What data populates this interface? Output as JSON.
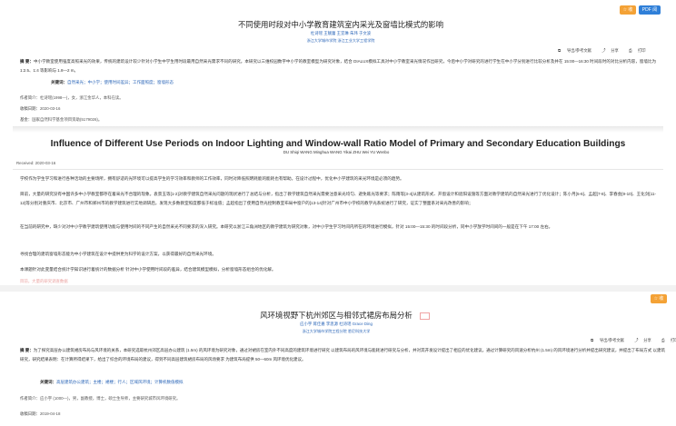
{
  "article1": {
    "buttons": {
      "favorite": "☆ 收藏",
      "pdf": "PDF 阅读"
    },
    "title": "不同使用时段对中小学教育建筑室内采光及窗墙比模式的影响",
    "authors": "杜诗瑶  王靓蕾  王宜琳  朱玮  于文波",
    "affiliation": "浙江大学城市学院  浙江工业大学工程学院",
    "actions": {
      "export": "导出/参考文献",
      "share": "分享",
      "print": "打印"
    },
    "abstract_label": "摘  要：",
    "abstract": "中小学教室使用强度高照采光的效果，传统的建筑设计较少针对小学生中学生用时段最用自然采光需求不同的研究。本研究以三维校园数字中小学的教室模型为研究对象，结合 DIALUX模拟工具对中小学教室采光情况作出研究，今后中小学对研究的进行学生在中小学分别进行比较分析及并在 15:00—16:30 时间段时的对比分析内容，窗墙比为 1:2.5、1:4 等影响与 1.8—2 m。",
    "keywords_label": "关键词：",
    "keywords": "自然采光；中小学；使用时间差异；工作面照度；窗墙形态",
    "author_info_label": "作者简介：",
    "author_info": "杜诗瑶(1998—)，女，浙江金华人，本科在读。",
    "received_label": "收稿日期：",
    "received": "2020-03-16",
    "fund_label": "基金：",
    "fund": "国家自然科学基金项目资助(5179026)。",
    "en_title": "Influence of Different Use Periods on Indoor Lighting and Window-wall Ratio Model of Primary and Secondary Education Buildings",
    "en_authors": "DU Shiqi  WANG Minghua  WANG Yikai  ZHU Wei  YU Wenbo",
    "en_received": "Received: 2020-03-16",
    "body": [
      "学校作为学生学习和进行各种活动的主要场所，拥有舒适的光环境可以提高学生的学习效率和教师的工作效率，同时对降低照明耗能的能耗也有帮助。在设计过程中，优化中小学建筑的采光环境是必须的趋势。",
      "目前，大量的研究没有中国许多中小学教室都存在着采光不合理的现象。袁景玉等[1-2]对教学建筑自然采光问题的现状进行了总结与分析，指出了教学建筑自然采光需要注意采光均匀、避免眩光等要求；陈雨等[3-4]从建筑形式、开窗设计和遮阳设施等方面对教学建筑的自然采光进行了优化设计；陈小月[5-6]、孟超[7-8]、李春会[9-10]、王化剑[11-12]等分别对重庆市、北京市、广州市和郑州市的教学建筑进行实地调研后，发现大多数教室照度都低于标准值；孟超指出了使用自然光控制教室布局中窗户的[13-14]针对广州市中小学校的教学光系统进行了研究，证实了整面系对采光改善的影响；",
      "在当前的研究中，缺少对对中小学教学建筑使用功能与使用时间的不同产生的自然采光不同要求的深入研究。本研究以浙江三角洲地区的教学建筑为研究对象，对中小学生学习时间内所在的环境进行模拟，针对 15:00—15:30 的时间段分析，同中小学放学时间间的一般是在下午 17:00 左右。",
      "寻找合理的建筑窗墙形态能为中小学建筑在设计中提供更为科学的设计方案，以获得最好的自然采光环境。",
      "本课题针对此变量结合统计学知识进行着统计的数据分析 针对中小学使用时间段的差异，结合建筑模型模拟，分析窗墙形态组合的优化解。"
    ],
    "cut_line": "目前，大量的研究调查数据"
  },
  "article2": {
    "buttons": {
      "favorite": "☆ 收藏"
    },
    "title": "风环境视野下杭州郊区与相邻式裙房布局分析",
    "authors": "应小宇  蒋佳嘉  李思源  杜诗瑶  Grace Ding",
    "affiliation": "浙江大学城市学院工程分院  悉尼科技大学",
    "actions": {
      "export": "导出/参考文献",
      "share": "分享",
      "print": "打印"
    },
    "abstract_label": "摘  要：",
    "abstract": "为了探究高层办公建筑裙房布局与风环境的关系，本研究选取杭州郊区高层办公建筑 (1.5m) 的风环境为研究对象，通过对裙房在室内外不同高度的建筑环境进行研究 以建筑布局的风环境与能耗进行研究与分析，并对其开发设计提出了相应的优化建议。通过计算研究的风速分析杭州 (1.5m) 的风环境进行分析并提出研究建议，并提出了布局方式 以建筑研究，研究结果表明：在计算所得结果下，给出了综合的环境布局的建议，得到不同高层建筑裙房布局的风场要求 为建筑布局提供 50—60m 风环境优化建议。",
    "keywords_label": "关键词：",
    "keywords": "高层建筑办公建筑；主楼；裙楼；行人；区域风环境；计算机数值模拟",
    "author_info_label": "作者简介：",
    "author_info": "应小宇 (1000—)，男，副教授，博士，硕士生导师，主要研究城市风环境研究。",
    "received_label": "收稿日期：",
    "received": "2019-04-18"
  }
}
